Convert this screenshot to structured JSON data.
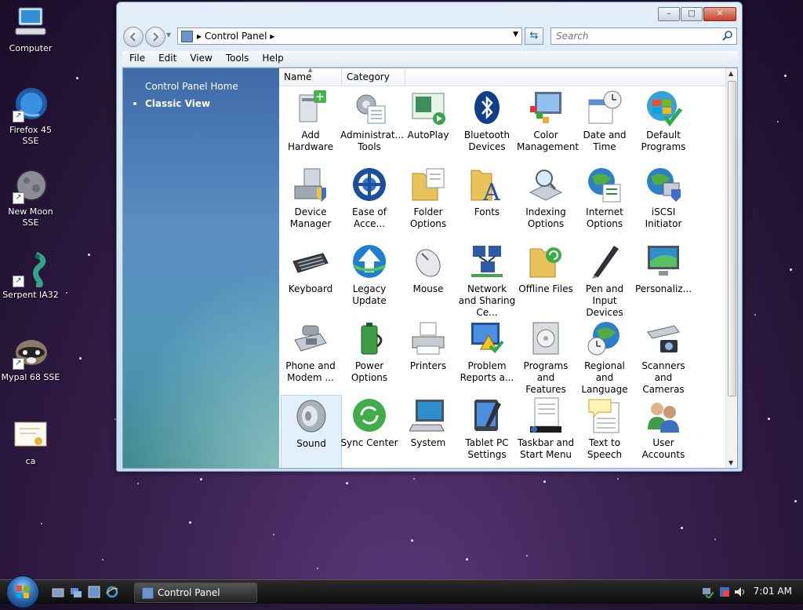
{
  "desktop": {
    "icons": [
      {
        "label": "Computer"
      },
      {
        "label": "Firefox 45 SSE"
      },
      {
        "label": "New Moon SSE"
      },
      {
        "label": "Serpent IA32"
      },
      {
        "label": "Mypal 68 SSE"
      },
      {
        "label": "ca"
      }
    ]
  },
  "window": {
    "address": {
      "location": "Control Panel"
    },
    "search": {
      "placeholder": "Search"
    },
    "caption": {
      "minimize": "–",
      "maximize": "□",
      "close": "✕"
    },
    "menu": [
      "File",
      "Edit",
      "View",
      "Tools",
      "Help"
    ],
    "left_pane": {
      "home_link": "Control Panel Home",
      "classic_view": "Classic View"
    },
    "columns": [
      "Name",
      "Category"
    ],
    "items": [
      {
        "label": "Add Hardware",
        "icon": "add-hardware-icon"
      },
      {
        "label": "Administrat... Tools",
        "icon": "administrative-tools-icon"
      },
      {
        "label": "AutoPlay",
        "icon": "autoplay-icon"
      },
      {
        "label": "Bluetooth Devices",
        "icon": "bluetooth-icon"
      },
      {
        "label": "Color Management",
        "icon": "color-management-icon"
      },
      {
        "label": "Date and Time",
        "icon": "date-time-icon"
      },
      {
        "label": "Default Programs",
        "icon": "default-programs-icon"
      },
      {
        "label": "Device Manager",
        "icon": "device-manager-icon"
      },
      {
        "label": "Ease of Acce...",
        "icon": "ease-of-access-icon"
      },
      {
        "label": "Folder Options",
        "icon": "folder-options-icon"
      },
      {
        "label": "Fonts",
        "icon": "fonts-icon"
      },
      {
        "label": "Indexing Options",
        "icon": "indexing-icon"
      },
      {
        "label": "Internet Options",
        "icon": "internet-options-icon"
      },
      {
        "label": "iSCSI Initiator",
        "icon": "iscsi-icon"
      },
      {
        "label": "Keyboard",
        "icon": "keyboard-icon"
      },
      {
        "label": "Legacy Update",
        "icon": "legacy-update-icon"
      },
      {
        "label": "Mouse",
        "icon": "mouse-icon"
      },
      {
        "label": "Network and Sharing Ce...",
        "icon": "network-icon"
      },
      {
        "label": "Offline Files",
        "icon": "offline-files-icon"
      },
      {
        "label": "Pen and Input Devices",
        "icon": "pen-icon"
      },
      {
        "label": "Personaliz...",
        "icon": "personalize-icon"
      },
      {
        "label": "Phone and Modem ...",
        "icon": "phone-icon"
      },
      {
        "label": "Power Options",
        "icon": "power-icon"
      },
      {
        "label": "Printers",
        "icon": "printer-icon"
      },
      {
        "label": "Problem Reports a...",
        "icon": "problem-reports-icon"
      },
      {
        "label": "Programs and Features",
        "icon": "programs-icon"
      },
      {
        "label": "Regional and Language ...",
        "icon": "regional-icon"
      },
      {
        "label": "Scanners and Cameras",
        "icon": "scanner-icon"
      },
      {
        "label": "Sound",
        "icon": "sound-icon"
      },
      {
        "label": "Sync Center",
        "icon": "sync-icon"
      },
      {
        "label": "System",
        "icon": "system-icon"
      },
      {
        "label": "Tablet PC Settings",
        "icon": "tablet-icon"
      },
      {
        "label": "Taskbar and Start Menu",
        "icon": "taskbar-icon"
      },
      {
        "label": "Text to Speech",
        "icon": "speech-icon"
      },
      {
        "label": "User Accounts",
        "icon": "user-accounts-icon"
      }
    ]
  },
  "taskbar": {
    "task_label": "Control Panel",
    "clock": "7:01 AM"
  }
}
